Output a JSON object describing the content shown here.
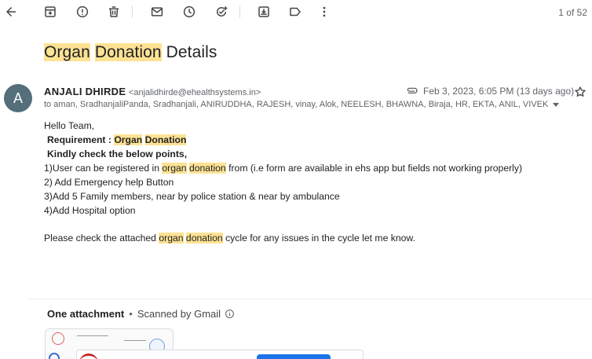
{
  "toolbar": {
    "icons": [
      "back-arrow-icon",
      "archive-icon",
      "report-spam-icon",
      "delete-icon",
      "mark-unread-icon",
      "snooze-icon",
      "add-to-tasks-icon",
      "move-to-icon",
      "label-icon",
      "more-vert-icon"
    ],
    "counter": "1 of 52"
  },
  "subject": {
    "part1": "Organ",
    "part2": "Donation",
    "part3": " Details"
  },
  "sender": {
    "avatar_letter": "A",
    "name": "ANJALI DHIRDE",
    "email": "<anjalidhirde@ehealthsystems.in>",
    "date": "Feb 3, 2023, 6:05 PM (13 days ago)",
    "to": "to aman, SradhanjaliPanda, Sradhanjali, ANIRUDDHA, RAJESH, vinay, Alok, NEELESH, BHAWNA, Biraja, HR, EKTA, ANIL, VIVEK"
  },
  "body": {
    "greeting": "Hello Team,",
    "req_label": "Requirement : ",
    "req_h1": "Organ",
    "req_h2": "Donation",
    "kindly": "Kindly check the below points,",
    "l1_pre": "1)User can be registered in ",
    "l1_h1": "organ",
    "l1_h2": "donation",
    "l1_post": " from (i.e form are available in ehs app but fields not working properly)",
    "l2": "2) Add Emergency help Button",
    "l3": "3)Add 5 Family members, near by police station & near by ambulance",
    "l4": "4)Add Hospital option",
    "closing_pre": "Please check the attached ",
    "closing_h1": "organ",
    "closing_h2": "donation",
    "closing_post": " cycle for any issues in the cycle let me know."
  },
  "attachments": {
    "title": "One attachment",
    "separator": "•",
    "scanned": "Scanned by Gmail"
  },
  "colors": {
    "highlight": "#fde293",
    "avatar_bg": "#546e7a",
    "accent_blue": "#1a73e8"
  }
}
